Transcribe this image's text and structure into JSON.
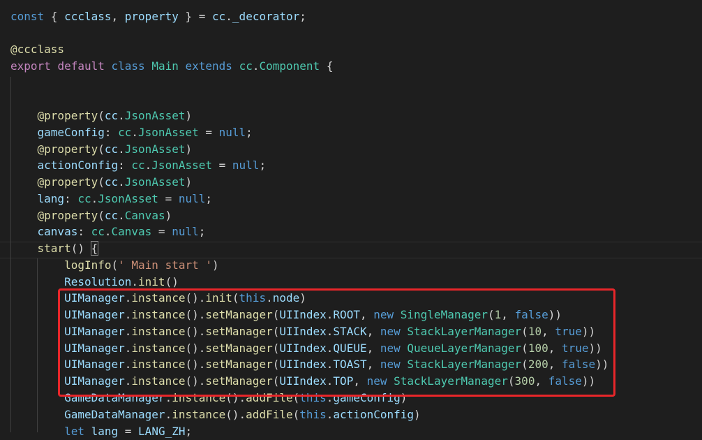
{
  "editor": {
    "highlight_color": "#e8262a",
    "lines": [
      {
        "t": [
          [
            "kw",
            "const"
          ],
          [
            "pl",
            " { "
          ],
          [
            "var",
            "ccclass"
          ],
          [
            "pl",
            ", "
          ],
          [
            "var",
            "property"
          ],
          [
            "pl",
            " } = "
          ],
          [
            "var",
            "cc"
          ],
          [
            "pl",
            "."
          ],
          [
            "var",
            "_decorator"
          ],
          [
            "pl",
            ";"
          ]
        ]
      },
      {
        "t": []
      },
      {
        "t": [
          [
            "dec",
            "@ccclass"
          ]
        ]
      },
      {
        "t": [
          [
            "ctl",
            "export"
          ],
          [
            "pl",
            " "
          ],
          [
            "ctl",
            "default"
          ],
          [
            "pl",
            " "
          ],
          [
            "kw",
            "class"
          ],
          [
            "pl",
            " "
          ],
          [
            "ty",
            "Main"
          ],
          [
            "pl",
            " "
          ],
          [
            "kw",
            "extends"
          ],
          [
            "pl",
            " "
          ],
          [
            "ty",
            "cc"
          ],
          [
            "pl",
            "."
          ],
          [
            "ty",
            "Component"
          ],
          [
            "pl",
            " {"
          ]
        ]
      },
      {
        "t": []
      },
      {
        "t": []
      },
      {
        "t": [
          [
            "pl",
            "    "
          ],
          [
            "dec",
            "@property"
          ],
          [
            "pl",
            "("
          ],
          [
            "var",
            "cc"
          ],
          [
            "pl",
            "."
          ],
          [
            "ty",
            "JsonAsset"
          ],
          [
            "pl",
            ")"
          ]
        ]
      },
      {
        "t": [
          [
            "pl",
            "    "
          ],
          [
            "var",
            "gameConfig"
          ],
          [
            "pl",
            ": "
          ],
          [
            "ty",
            "cc"
          ],
          [
            "pl",
            "."
          ],
          [
            "ty",
            "JsonAsset"
          ],
          [
            "pl",
            " = "
          ],
          [
            "kw",
            "null"
          ],
          [
            "pl",
            ";"
          ]
        ]
      },
      {
        "t": [
          [
            "pl",
            "    "
          ],
          [
            "dec",
            "@property"
          ],
          [
            "pl",
            "("
          ],
          [
            "var",
            "cc"
          ],
          [
            "pl",
            "."
          ],
          [
            "ty",
            "JsonAsset"
          ],
          [
            "pl",
            ")"
          ]
        ]
      },
      {
        "t": [
          [
            "pl",
            "    "
          ],
          [
            "var",
            "actionConfig"
          ],
          [
            "pl",
            ": "
          ],
          [
            "ty",
            "cc"
          ],
          [
            "pl",
            "."
          ],
          [
            "ty",
            "JsonAsset"
          ],
          [
            "pl",
            " = "
          ],
          [
            "kw",
            "null"
          ],
          [
            "pl",
            ";"
          ]
        ]
      },
      {
        "t": [
          [
            "pl",
            "    "
          ],
          [
            "dec",
            "@property"
          ],
          [
            "pl",
            "("
          ],
          [
            "var",
            "cc"
          ],
          [
            "pl",
            "."
          ],
          [
            "ty",
            "JsonAsset"
          ],
          [
            "pl",
            ")"
          ]
        ]
      },
      {
        "t": [
          [
            "pl",
            "    "
          ],
          [
            "var",
            "lang"
          ],
          [
            "pl",
            ": "
          ],
          [
            "ty",
            "cc"
          ],
          [
            "pl",
            "."
          ],
          [
            "ty",
            "JsonAsset"
          ],
          [
            "pl",
            " = "
          ],
          [
            "kw",
            "null"
          ],
          [
            "pl",
            ";"
          ]
        ]
      },
      {
        "t": [
          [
            "pl",
            "    "
          ],
          [
            "dec",
            "@property"
          ],
          [
            "pl",
            "("
          ],
          [
            "var",
            "cc"
          ],
          [
            "pl",
            "."
          ],
          [
            "ty",
            "Canvas"
          ],
          [
            "pl",
            ")"
          ]
        ]
      },
      {
        "t": [
          [
            "pl",
            "    "
          ],
          [
            "var",
            "canvas"
          ],
          [
            "pl",
            ": "
          ],
          [
            "ty",
            "cc"
          ],
          [
            "pl",
            "."
          ],
          [
            "ty",
            "Canvas"
          ],
          [
            "pl",
            " = "
          ],
          [
            "kw",
            "null"
          ],
          [
            "pl",
            ";"
          ]
        ]
      },
      {
        "t": [
          [
            "pl",
            "    "
          ],
          [
            "fn",
            "start"
          ],
          [
            "pl",
            "() "
          ],
          [
            "brmatch",
            "{"
          ]
        ]
      },
      {
        "t": [
          [
            "pl",
            "        "
          ],
          [
            "fn",
            "logInfo"
          ],
          [
            "pl",
            "("
          ],
          [
            "str",
            "' Main start '"
          ],
          [
            "pl",
            ")"
          ]
        ]
      },
      {
        "t": [
          [
            "pl",
            "        "
          ],
          [
            "var",
            "Resolution"
          ],
          [
            "pl",
            "."
          ],
          [
            "fn",
            "init"
          ],
          [
            "pl",
            "()"
          ]
        ]
      },
      {
        "t": [
          [
            "pl",
            "        "
          ],
          [
            "var",
            "UIManager"
          ],
          [
            "pl",
            "."
          ],
          [
            "fn",
            "instance"
          ],
          [
            "pl",
            "()."
          ],
          [
            "fn",
            "init"
          ],
          [
            "pl",
            "("
          ],
          [
            "kw",
            "this"
          ],
          [
            "pl",
            "."
          ],
          [
            "var",
            "node"
          ],
          [
            "pl",
            ")"
          ]
        ]
      },
      {
        "t": [
          [
            "pl",
            "        "
          ],
          [
            "var",
            "UIManager"
          ],
          [
            "pl",
            "."
          ],
          [
            "fn",
            "instance"
          ],
          [
            "pl",
            "()."
          ],
          [
            "fn",
            "setManager"
          ],
          [
            "pl",
            "("
          ],
          [
            "var",
            "UIIndex"
          ],
          [
            "pl",
            "."
          ],
          [
            "var",
            "ROOT"
          ],
          [
            "pl",
            ", "
          ],
          [
            "kw",
            "new"
          ],
          [
            "pl",
            " "
          ],
          [
            "ty",
            "SingleManager"
          ],
          [
            "pl",
            "("
          ],
          [
            "num",
            "1"
          ],
          [
            "pl",
            ", "
          ],
          [
            "kw",
            "false"
          ],
          [
            "pl",
            "))"
          ]
        ]
      },
      {
        "t": [
          [
            "pl",
            "        "
          ],
          [
            "var",
            "UIManager"
          ],
          [
            "pl",
            "."
          ],
          [
            "fn",
            "instance"
          ],
          [
            "pl",
            "()."
          ],
          [
            "fn",
            "setManager"
          ],
          [
            "pl",
            "("
          ],
          [
            "var",
            "UIIndex"
          ],
          [
            "pl",
            "."
          ],
          [
            "var",
            "STACK"
          ],
          [
            "pl",
            ", "
          ],
          [
            "kw",
            "new"
          ],
          [
            "pl",
            " "
          ],
          [
            "ty",
            "StackLayerManager"
          ],
          [
            "pl",
            "("
          ],
          [
            "num",
            "10"
          ],
          [
            "pl",
            ", "
          ],
          [
            "kw",
            "true"
          ],
          [
            "pl",
            "))"
          ]
        ]
      },
      {
        "t": [
          [
            "pl",
            "        "
          ],
          [
            "var",
            "UIManager"
          ],
          [
            "pl",
            "."
          ],
          [
            "fn",
            "instance"
          ],
          [
            "pl",
            "()."
          ],
          [
            "fn",
            "setManager"
          ],
          [
            "pl",
            "("
          ],
          [
            "var",
            "UIIndex"
          ],
          [
            "pl",
            "."
          ],
          [
            "var",
            "QUEUE"
          ],
          [
            "pl",
            ", "
          ],
          [
            "kw",
            "new"
          ],
          [
            "pl",
            " "
          ],
          [
            "ty",
            "QueueLayerManager"
          ],
          [
            "pl",
            "("
          ],
          [
            "num",
            "100"
          ],
          [
            "pl",
            ", "
          ],
          [
            "kw",
            "true"
          ],
          [
            "pl",
            "))"
          ]
        ]
      },
      {
        "t": [
          [
            "pl",
            "        "
          ],
          [
            "var",
            "UIManager"
          ],
          [
            "pl",
            "."
          ],
          [
            "fn",
            "instance"
          ],
          [
            "pl",
            "()."
          ],
          [
            "fn",
            "setManager"
          ],
          [
            "pl",
            "("
          ],
          [
            "var",
            "UIIndex"
          ],
          [
            "pl",
            "."
          ],
          [
            "var",
            "TOAST"
          ],
          [
            "pl",
            ", "
          ],
          [
            "kw",
            "new"
          ],
          [
            "pl",
            " "
          ],
          [
            "ty",
            "StackLayerManager"
          ],
          [
            "pl",
            "("
          ],
          [
            "num",
            "200"
          ],
          [
            "pl",
            ", "
          ],
          [
            "kw",
            "false"
          ],
          [
            "pl",
            "))"
          ]
        ]
      },
      {
        "t": [
          [
            "pl",
            "        "
          ],
          [
            "var",
            "UIManager"
          ],
          [
            "pl",
            "."
          ],
          [
            "fn",
            "instance"
          ],
          [
            "pl",
            "()."
          ],
          [
            "fn",
            "setManager"
          ],
          [
            "pl",
            "("
          ],
          [
            "var",
            "UIIndex"
          ],
          [
            "pl",
            "."
          ],
          [
            "var",
            "TOP"
          ],
          [
            "pl",
            ", "
          ],
          [
            "kw",
            "new"
          ],
          [
            "pl",
            " "
          ],
          [
            "ty",
            "StackLayerManager"
          ],
          [
            "pl",
            "("
          ],
          [
            "num",
            "300"
          ],
          [
            "pl",
            ", "
          ],
          [
            "kw",
            "false"
          ],
          [
            "pl",
            "))"
          ]
        ]
      },
      {
        "t": [
          [
            "pl",
            "        "
          ],
          [
            "var",
            "GameDataManager"
          ],
          [
            "pl",
            "."
          ],
          [
            "fn",
            "instance"
          ],
          [
            "pl",
            "()."
          ],
          [
            "fn",
            "addFile"
          ],
          [
            "pl",
            "("
          ],
          [
            "kw",
            "this"
          ],
          [
            "pl",
            "."
          ],
          [
            "var",
            "gameConfig"
          ],
          [
            "pl",
            ")"
          ]
        ]
      },
      {
        "t": [
          [
            "pl",
            "        "
          ],
          [
            "var",
            "GameDataManager"
          ],
          [
            "pl",
            "."
          ],
          [
            "fn",
            "instance"
          ],
          [
            "pl",
            "()."
          ],
          [
            "fn",
            "addFile"
          ],
          [
            "pl",
            "("
          ],
          [
            "kw",
            "this"
          ],
          [
            "pl",
            "."
          ],
          [
            "var",
            "actionConfig"
          ],
          [
            "pl",
            ")"
          ]
        ]
      },
      {
        "t": [
          [
            "pl",
            "        "
          ],
          [
            "kw",
            "let"
          ],
          [
            "pl",
            " "
          ],
          [
            "var",
            "lang"
          ],
          [
            "pl",
            " = "
          ],
          [
            "var",
            "LANG_ZH"
          ],
          [
            "pl",
            ";"
          ]
        ]
      }
    ]
  }
}
